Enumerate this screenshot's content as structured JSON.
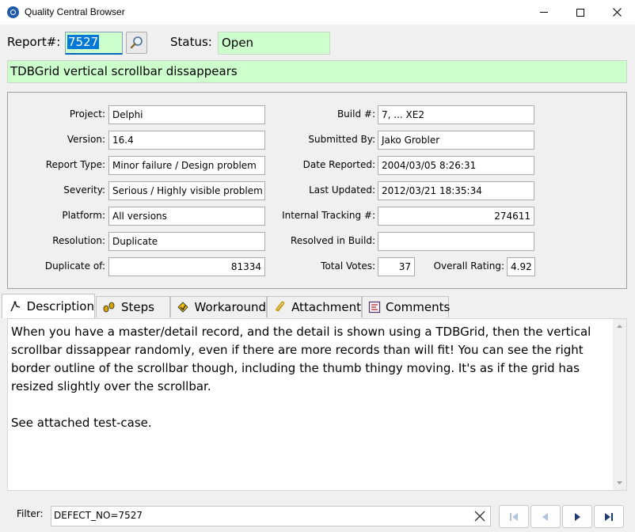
{
  "window": {
    "title": "Quality Central Browser"
  },
  "report": {
    "label": "Report#:",
    "number": "7527",
    "status_label": "Status:",
    "status_value": "Open",
    "title": "TDBGrid vertical scrollbar dissappears"
  },
  "details": {
    "project_label": "Project:",
    "project": "Delphi",
    "version_label": "Version:",
    "version": "16.4",
    "report_type_label": "Report Type:",
    "report_type": "Minor failure / Design problem",
    "severity_label": "Severity:",
    "severity": "Serious / Highly visible problem",
    "platform_label": "Platform:",
    "platform": "All versions",
    "resolution_label": "Resolution:",
    "resolution": "Duplicate",
    "duplicate_label": "Duplicate of:",
    "duplicate": "81334",
    "build_label": "Build #:",
    "build": "7, ... XE2",
    "submitted_label": "Submitted By:",
    "submitted": "Jako Grobler",
    "date_reported_label": "Date Reported:",
    "date_reported": "2004/03/05 8:26:31",
    "last_updated_label": "Last Updated:",
    "last_updated": "2012/03/21 18:35:34",
    "tracking_label": "Internal Tracking #:",
    "tracking": "274611",
    "resolved_label": "Resolved in Build:",
    "resolved": "",
    "votes_label": "Total Votes:",
    "votes": "37",
    "rating_label": "Overall Rating:",
    "rating": "4.92"
  },
  "tabs": [
    {
      "label": "Description",
      "icon": "description-icon"
    },
    {
      "label": "Steps",
      "icon": "steps-icon"
    },
    {
      "label": "Workaround",
      "icon": "workaround-icon"
    },
    {
      "label": "Attachment",
      "icon": "paperclip-icon"
    },
    {
      "label": "Comments",
      "icon": "comments-icon"
    }
  ],
  "description": {
    "text": "When you have a master/detail record, and the detail is shown using a TDBGrid, then the vertical scrollbar dissappear randomly, even if there are more records than will fit! You can see the right border outline of the scrollbar though, including the thumb thingy moving. It's as if the grid has resized slightly over the scrollbar.\n\nSee attached test-case."
  },
  "filter": {
    "label": "Filter:",
    "value": "DEFECT_NO=7527"
  },
  "colors": {
    "field_green": "#ccffcc",
    "selection_blue": "#0078d7"
  }
}
